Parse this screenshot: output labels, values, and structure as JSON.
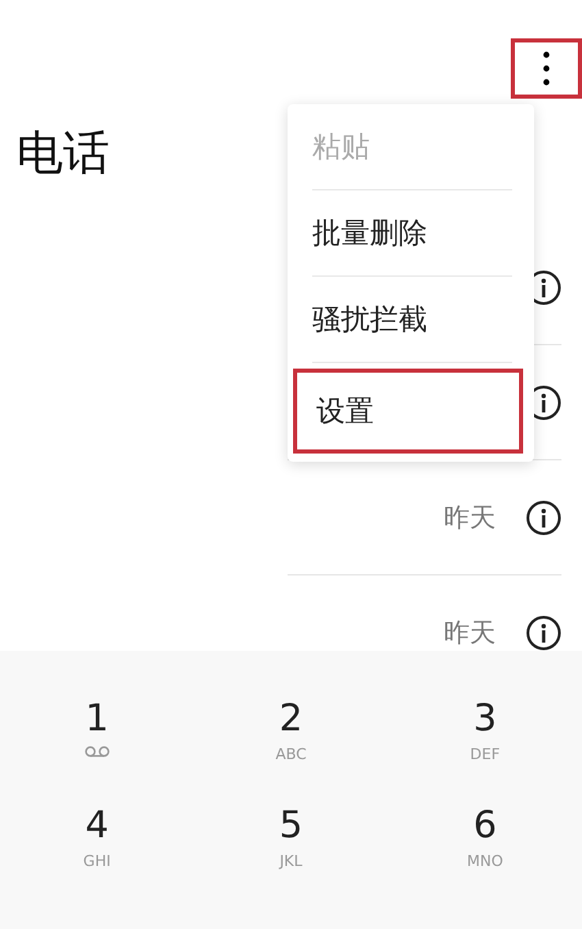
{
  "toolbar": {
    "more_button": {
      "highlighted": true
    }
  },
  "title": "电话",
  "calls": [
    {
      "info": true
    },
    {
      "info": true
    },
    {
      "date": "昨天",
      "info": true
    },
    {
      "date": "昨天",
      "info": true
    }
  ],
  "menu": [
    {
      "label": "粘贴",
      "disabled": true,
      "highlighted": false
    },
    {
      "label": "批量删除",
      "disabled": false,
      "highlighted": false
    },
    {
      "label": "骚扰拦截",
      "disabled": false,
      "highlighted": false
    },
    {
      "label": "设置",
      "disabled": false,
      "highlighted": true
    }
  ],
  "keypad": [
    {
      "digit": "1",
      "kind": "voicemail"
    },
    {
      "digit": "2",
      "letters": "ABC",
      "kind": "letters"
    },
    {
      "digit": "3",
      "letters": "DEF",
      "kind": "letters"
    },
    {
      "digit": "4",
      "letters": "GHI",
      "kind": "letters"
    },
    {
      "digit": "5",
      "letters": "JKL",
      "kind": "letters"
    },
    {
      "digit": "6",
      "letters": "MNO",
      "kind": "letters"
    }
  ]
}
